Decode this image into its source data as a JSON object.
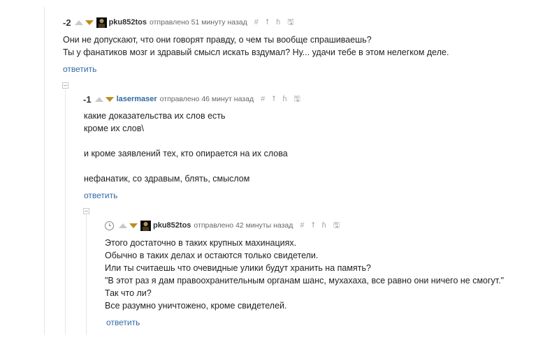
{
  "comments": [
    {
      "rating": "-2",
      "username": "pku852tos",
      "posted": "отправлено 51 минуту назад",
      "lines": [
        "Они не допускают, что они говорят правду, о чем ты вообще спрашиваешь?",
        "Ты у фанатиков мозг и здравый смысл искать вздумал? Ну... удачи тебе в этом нелегком деле."
      ],
      "reply": "ответить"
    },
    {
      "rating": "-1",
      "username": "lasermaser",
      "posted": "отправлено 46 минут назад",
      "lines": [
        "какие доказательства их слов есть",
        "кроме их слов\\",
        "и кроме заявлений тех, кто опирается на их слова",
        "нефанатик, со здравым, блять, смыслом"
      ],
      "reply": "ответить"
    },
    {
      "username": "pku852tos",
      "posted": "отправлено 42 минуты назад",
      "lines": [
        "Этого достаточно в таких крупных махинациях.",
        "Обычно в таких делах и остаются только свидетели.",
        "Или ты считаешь что очевидные улики будут хранить на память?",
        "\"В этот раз я дам правоохранительным органам шанс, мухахаха, все равно они ничего не смогут.\"",
        "Так что ли?",
        "Все разумно уничтожено, кроме свидетелей."
      ],
      "reply": "ответить"
    }
  ],
  "icons": {
    "hash": "#",
    "parent": "⭡",
    "thread": "ɦ",
    "save": "🖫"
  },
  "colors": {
    "link": "#2e6aa5",
    "downvote": "#b98f1d",
    "upvote": "#c9c9c9"
  }
}
